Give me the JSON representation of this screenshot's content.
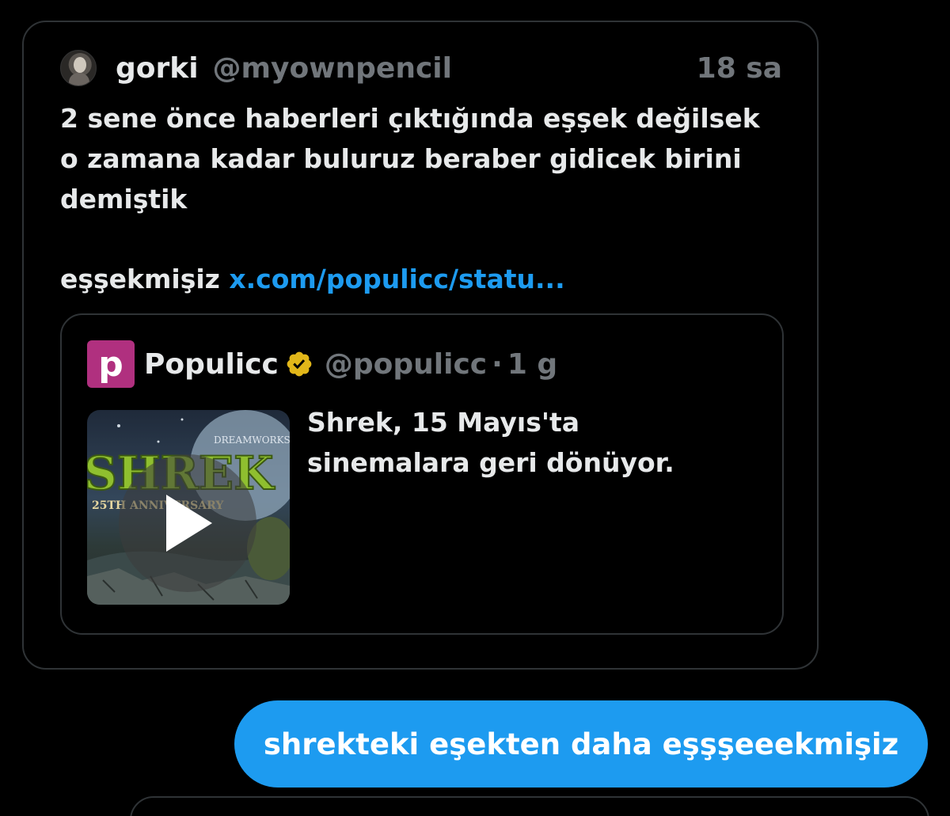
{
  "tweet": {
    "author_name": "gorki",
    "author_handle": "@myownpencil",
    "timestamp": "18 sa",
    "text_line_1": "2 sene önce haberleri çıktığında eşşek değilsek\no zamana kadar buluruz beraber gidicek birini\ndemiştik",
    "text_prefix": "eşşekmişiz ",
    "link_text": "x.com/populicc/statu..."
  },
  "quote": {
    "logo_letter": "p",
    "name": "Populicc",
    "handle": "@populicc",
    "separator": "·",
    "time": "1 g",
    "text": "Shrek, 15 Mayıs'ta\nsinemalara geri dönüyor.",
    "video_title_text": "SHREK",
    "video_subtitle_text": "25TH ANNIVERSARY",
    "video_brand_text": "DREAMWORKS"
  },
  "message": {
    "text": "shrekteki eşekten daha eşşşeeekmişiz"
  },
  "colors": {
    "background": "#000000",
    "border": "#2f3336",
    "link": "#1d9bf0",
    "bubble": "#1d9bf0",
    "muted": "#71767b",
    "text": "#e7e9ea",
    "logo": "#b0307f",
    "verified": "#e2b719"
  },
  "icons": {
    "verified": "verified-badge-icon",
    "play": "play-icon"
  }
}
